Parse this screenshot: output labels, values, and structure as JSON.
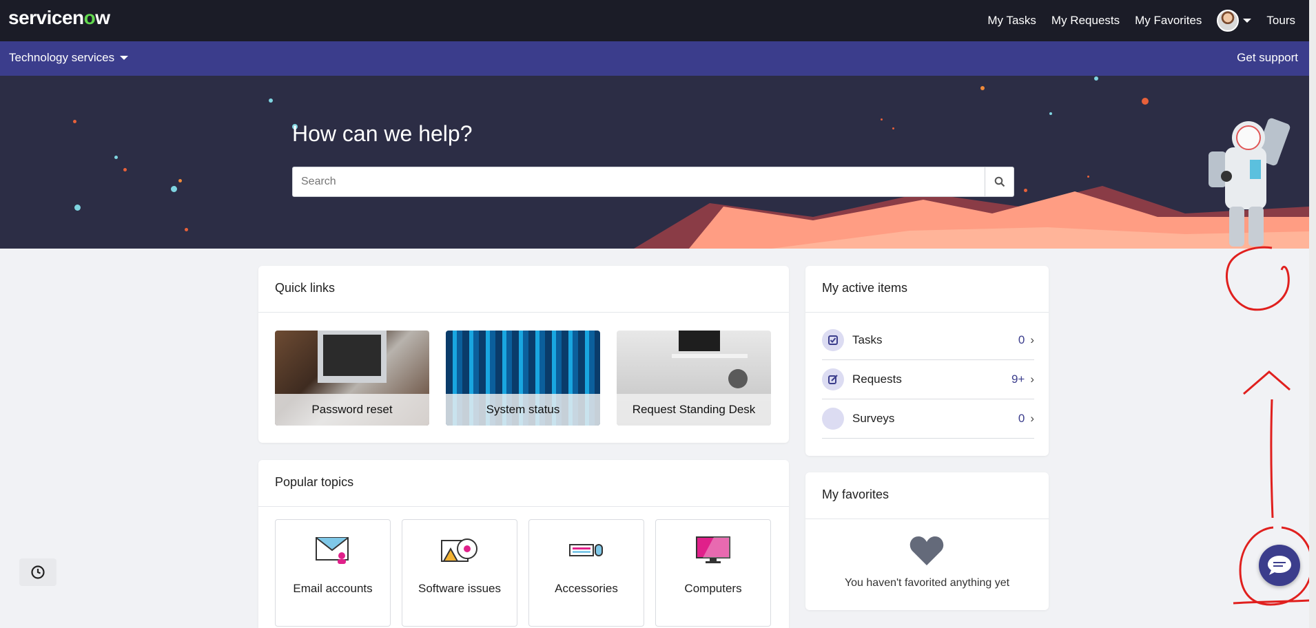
{
  "header": {
    "logo": "servicenow",
    "nav": [
      "My Tasks",
      "My Requests",
      "My Favorites"
    ],
    "tours": "Tours"
  },
  "subnav": {
    "portal": "Technology services",
    "get_support": "Get support"
  },
  "hero": {
    "title": "How can we help?",
    "search_placeholder": "Search"
  },
  "quick_links": {
    "title": "Quick links",
    "items": [
      "Password reset",
      "System status",
      "Request Standing Desk"
    ]
  },
  "popular_topics": {
    "title": "Popular topics",
    "items": [
      "Email accounts",
      "Software issues",
      "Accessories",
      "Computers"
    ]
  },
  "active_items": {
    "title": "My active items",
    "items": [
      {
        "label": "Tasks",
        "count": "0"
      },
      {
        "label": "Requests",
        "count": "9+"
      },
      {
        "label": "Surveys",
        "count": "0"
      }
    ]
  },
  "favorites": {
    "title": "My favorites",
    "empty": "You haven't favorited anything yet"
  },
  "icons": {
    "search": "search-icon",
    "history": "history-icon",
    "chat": "chat-icon",
    "heart": "heart-icon"
  },
  "colors": {
    "topbar": "#1b1c27",
    "subbar": "#3b3d8c",
    "hero": "#2c2d45",
    "accent": "#3b3d8c",
    "annotation": "#e0201e"
  }
}
